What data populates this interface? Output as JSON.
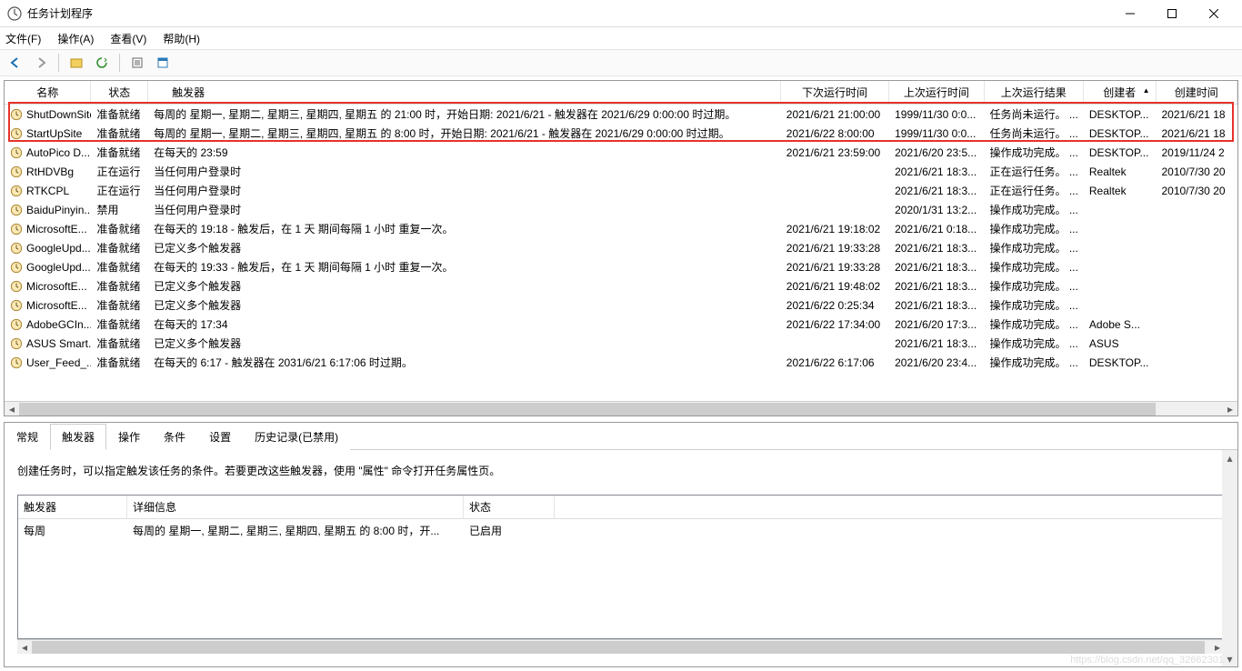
{
  "window": {
    "title": "任务计划程序"
  },
  "menu": {
    "file": "文件(F)",
    "action": "操作(A)",
    "view": "查看(V)",
    "help": "帮助(H)"
  },
  "columns": {
    "name": "名称",
    "status": "状态",
    "trigger": "触发器",
    "next": "下次运行时间",
    "last": "上次运行时间",
    "result": "上次运行结果",
    "author": "创建者",
    "created": "创建时间"
  },
  "tasks": [
    {
      "name": "ShutDownSite",
      "status": "准备就绪",
      "trigger": "每周的 星期一, 星期二, 星期三, 星期四, 星期五 的 21:00 时，开始日期: 2021/6/21 - 触发器在 2021/6/29 0:00:00 时过期。",
      "next": "2021/6/21 21:00:00",
      "last": "1999/11/30 0:0...",
      "result": "任务尚未运行。",
      "resultExtra": "...",
      "author": "DESKTOP...",
      "created": "2021/6/21 18",
      "highlight": true
    },
    {
      "name": "StartUpSite",
      "status": "准备就绪",
      "trigger": "每周的 星期一, 星期二, 星期三, 星期四, 星期五 的 8:00 时，开始日期: 2021/6/21 - 触发器在 2021/6/29 0:00:00 时过期。",
      "next": "2021/6/22 8:00:00",
      "last": "1999/11/30 0:0...",
      "result": "任务尚未运行。",
      "resultExtra": "...",
      "author": "DESKTOP...",
      "created": "2021/6/21 18",
      "highlight": true
    },
    {
      "name": "AutoPico D...",
      "status": "准备就绪",
      "trigger": "在每天的 23:59",
      "next": "2021/6/21 23:59:00",
      "last": "2021/6/20 23:5...",
      "result": "操作成功完成。",
      "resultExtra": "...",
      "author": "DESKTOP...",
      "created": "2019/11/24 2"
    },
    {
      "name": "RtHDVBg",
      "status": "正在运行",
      "trigger": "当任何用户登录时",
      "next": "",
      "last": "2021/6/21 18:3...",
      "result": "正在运行任务。",
      "resultExtra": "...",
      "author": "Realtek",
      "created": "2010/7/30 20"
    },
    {
      "name": "RTKCPL",
      "status": "正在运行",
      "trigger": "当任何用户登录时",
      "next": "",
      "last": "2021/6/21 18:3...",
      "result": "正在运行任务。",
      "resultExtra": "...",
      "author": "Realtek",
      "created": "2010/7/30 20"
    },
    {
      "name": "BaiduPinyin...",
      "status": "禁用",
      "trigger": "当任何用户登录时",
      "next": "",
      "last": "2020/1/31 13:2...",
      "result": "操作成功完成。",
      "resultExtra": "...",
      "author": "",
      "created": ""
    },
    {
      "name": "MicrosoftE...",
      "status": "准备就绪",
      "trigger": "在每天的 19:18 - 触发后，在 1 天 期间每隔 1 小时 重复一次。",
      "next": "2021/6/21 19:18:02",
      "last": "2021/6/21 0:18...",
      "result": "操作成功完成。",
      "resultExtra": "...",
      "author": "",
      "created": ""
    },
    {
      "name": "GoogleUpd...",
      "status": "准备就绪",
      "trigger": "已定义多个触发器",
      "next": "2021/6/21 19:33:28",
      "last": "2021/6/21 18:3...",
      "result": "操作成功完成。",
      "resultExtra": "...",
      "author": "",
      "created": ""
    },
    {
      "name": "GoogleUpd...",
      "status": "准备就绪",
      "trigger": "在每天的 19:33 - 触发后，在 1 天 期间每隔 1 小时 重复一次。",
      "next": "2021/6/21 19:33:28",
      "last": "2021/6/21 18:3...",
      "result": "操作成功完成。",
      "resultExtra": "...",
      "author": "",
      "created": ""
    },
    {
      "name": "MicrosoftE...",
      "status": "准备就绪",
      "trigger": "已定义多个触发器",
      "next": "2021/6/21 19:48:02",
      "last": "2021/6/21 18:3...",
      "result": "操作成功完成。",
      "resultExtra": "...",
      "author": "",
      "created": ""
    },
    {
      "name": "MicrosoftE...",
      "status": "准备就绪",
      "trigger": "已定义多个触发器",
      "next": "2021/6/22 0:25:34",
      "last": "2021/6/21 18:3...",
      "result": "操作成功完成。",
      "resultExtra": "...",
      "author": "",
      "created": ""
    },
    {
      "name": "AdobeGCIn...",
      "status": "准备就绪",
      "trigger": "在每天的 17:34",
      "next": "2021/6/22 17:34:00",
      "last": "2021/6/20 17:3...",
      "result": "操作成功完成。",
      "resultExtra": "...",
      "author": "Adobe S...",
      "created": ""
    },
    {
      "name": "ASUS Smart...",
      "status": "准备就绪",
      "trigger": "已定义多个触发器",
      "next": "",
      "last": "2021/6/21 18:3...",
      "result": "操作成功完成。",
      "resultExtra": "...",
      "author": "ASUS",
      "created": ""
    },
    {
      "name": "User_Feed_...",
      "status": "准备就绪",
      "trigger": "在每天的 6:17 - 触发器在 2031/6/21 6:17:06 时过期。",
      "next": "2021/6/22 6:17:06",
      "last": "2021/6/20 23:4...",
      "result": "操作成功完成。",
      "resultExtra": "...",
      "author": "DESKTOP...",
      "created": ""
    }
  ],
  "detail_tabs": {
    "general": "常规",
    "triggers": "触发器",
    "actions": "操作",
    "conditions": "条件",
    "settings": "设置",
    "history": "历史记录(已禁用)"
  },
  "detail": {
    "desc": "创建任务时，可以指定触发该任务的条件。若要更改这些触发器，使用 \"属性\" 命令打开任务属性页。",
    "cols": {
      "trigger": "触发器",
      "detail": "详细信息",
      "status": "状态"
    },
    "rows": [
      {
        "trigger": "每周",
        "detail": "每周的 星期一, 星期二, 星期三, 星期四, 星期五 的 8:00 时，开...",
        "status": "已启用"
      }
    ]
  },
  "watermark": "https://blog.csdn.net/qq_32662301"
}
